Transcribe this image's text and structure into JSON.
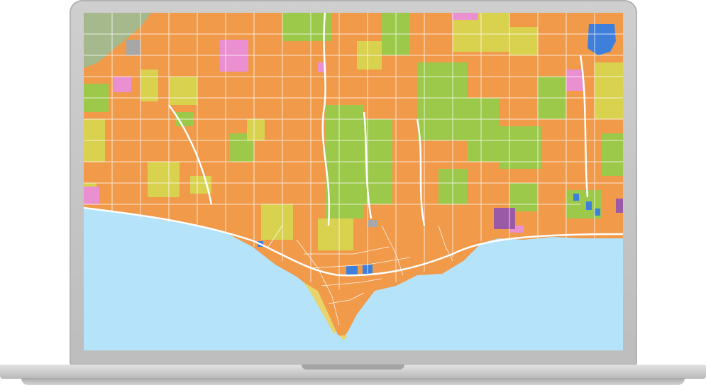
{
  "device": {
    "type": "laptop",
    "frame_color": "#c4c4c4",
    "base_color": "#d2d2d2"
  },
  "map": {
    "ocean_color": "#b5e3fa",
    "road_color": "#ffffff",
    "land_use_colors": {
      "orange": "#f09a4a",
      "yellow": "#d9d24f",
      "green": "#9cc94a",
      "pink": "#ea8fd0",
      "purple": "#9b5aa5",
      "blue": "#3f7fdc",
      "gray": "#a7a7a7",
      "terrain": "#a6b98c"
    }
  }
}
